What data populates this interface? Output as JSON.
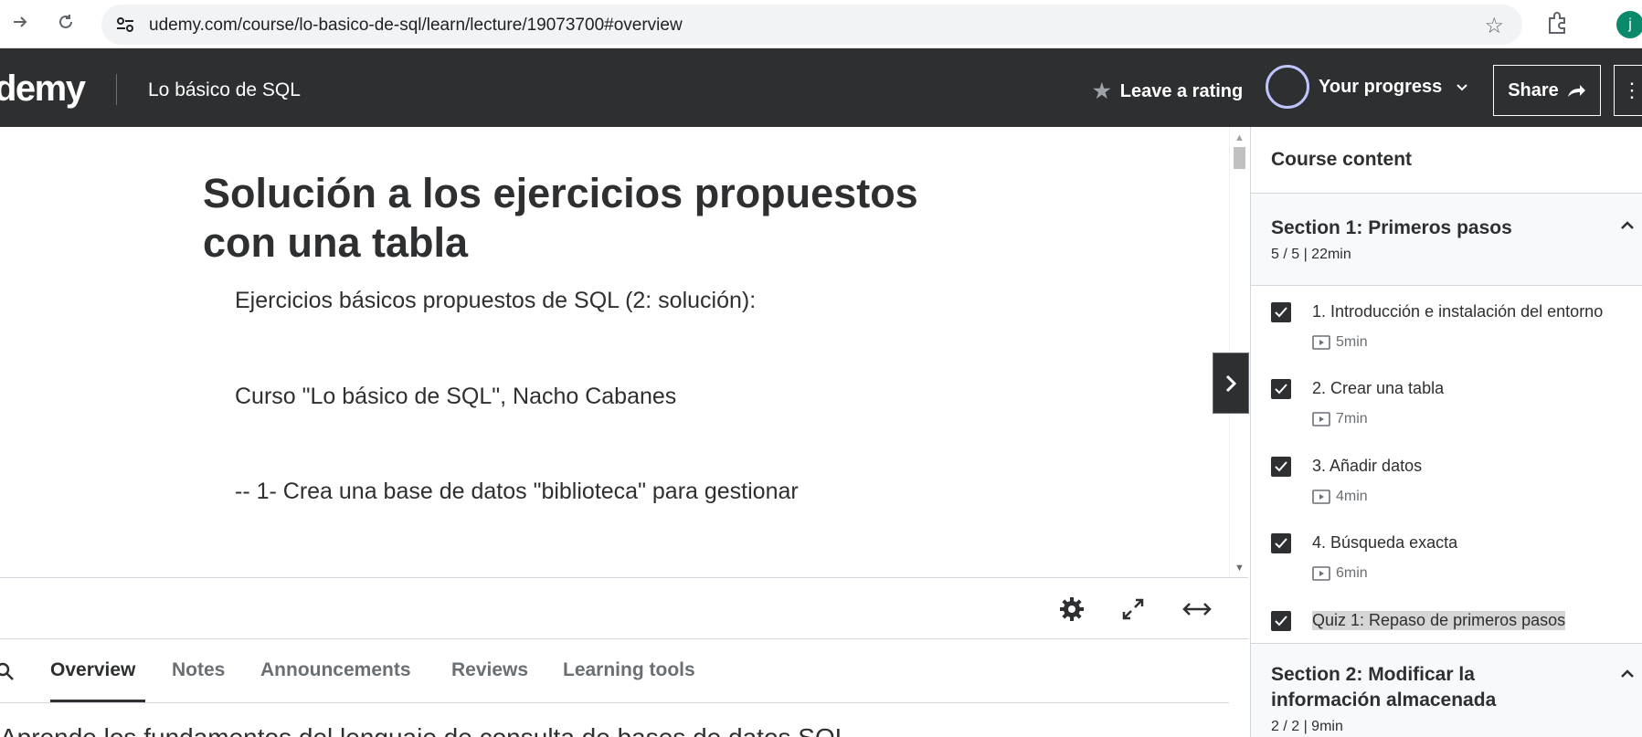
{
  "browser": {
    "url": "udemy.com/course/lo-basico-de-sql/learn/lecture/19073700#overview",
    "profile_initial": "j"
  },
  "header": {
    "logo": "demy",
    "course_title": "Lo básico de SQL",
    "leave_rating": "Leave a rating",
    "your_progress": "Your progress",
    "share": "Share",
    "more": "⋮"
  },
  "lecture": {
    "title": "Solución a los ejercicios propuestos con una tabla",
    "paragraphs": [
      "Ejercicios básicos propuestos de SQL (2: solución):",
      "Curso \"Lo básico de SQL\", Nacho Cabanes",
      "-- 1- Crea una base de datos \"biblioteca\" para gestionar"
    ]
  },
  "tabs": {
    "items": [
      "Overview",
      "Notes",
      "Announcements",
      "Reviews",
      "Learning tools"
    ],
    "active": "Overview"
  },
  "overview_text": "Aprende los fundamentos del lenguaje de consulta de bases de datos SQL",
  "sidebar": {
    "title": "Course content",
    "sections": [
      {
        "title": "Section 1: Primeros pasos",
        "meta": "5 / 5 | 22min",
        "lessons": [
          {
            "title": "1. Introducción e instalación del entorno",
            "duration": "5min"
          },
          {
            "title": "2. Crear una tabla",
            "duration": "7min"
          },
          {
            "title": "3. Añadir datos",
            "duration": "4min"
          },
          {
            "title": "4. Búsqueda exacta",
            "duration": "6min"
          },
          {
            "title": "Quiz 1: Repaso de primeros pasos",
            "duration": ""
          }
        ]
      },
      {
        "title": "Section 2: Modificar la información almacenada",
        "meta": "2 / 2 | 9min",
        "lessons": []
      }
    ]
  },
  "colors": {
    "header_bg": "#2d2f31",
    "progress_ring": "#c0c4fc",
    "section_bg": "#f7f9fa"
  }
}
